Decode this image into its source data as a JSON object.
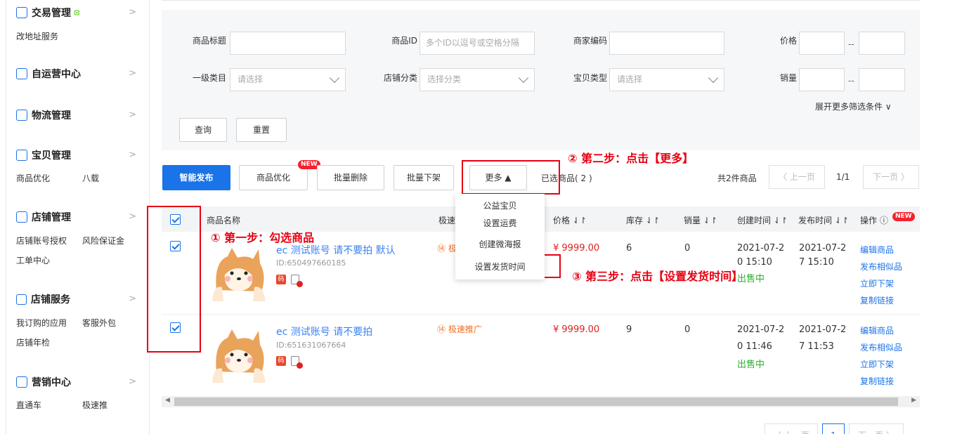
{
  "sidebar": {
    "sections": [
      {
        "title": "交易管理",
        "subs": [
          "改地址服务"
        ]
      },
      {
        "title": "自运营中心",
        "subs": []
      },
      {
        "title": "物流管理",
        "subs": []
      },
      {
        "title": "宝贝管理",
        "subs": [
          "商品优化",
          "八载"
        ]
      },
      {
        "title": "店铺管理",
        "subs": [
          "店铺账号授权",
          "风险保证金",
          "工单中心"
        ]
      },
      {
        "title": "店铺服务",
        "subs": [
          "我订购的应用",
          "客服外包",
          "店铺年检"
        ]
      },
      {
        "title": "营销中心",
        "subs": [
          "直通车",
          "极速推"
        ]
      }
    ],
    "chevron": ">"
  },
  "filter": {
    "labels": {
      "title": "商品标题",
      "id": "商品ID",
      "merchant_code": "商家编码",
      "price": "价格",
      "category": "一级类目",
      "shop_category": "店铺分类",
      "item_type": "宝贝类型",
      "sales": "销量"
    },
    "placeholders": {
      "id": "多个ID以逗号或空格分隔",
      "category": "请选择",
      "shop_category": "选择分类",
      "item_type": "请选择"
    },
    "range_sep": "--",
    "expand": "展开更多筛选条件 ∨",
    "query_btn": "查询",
    "reset_btn": "重置"
  },
  "toolbar": {
    "smart_publish": "智能发布",
    "optimize": "商品优化",
    "optimize_badge": "NEW",
    "batch_delete": "批量删除",
    "batch_offshelf": "批量下架",
    "more": "更多 ▲",
    "selected": "已选商品( 2 )",
    "total": "共2件商品",
    "prev": "〈 上一页",
    "page": "1/1",
    "next": "下一页 〉"
  },
  "more_menu": [
    "公益宝贝",
    "设置运费",
    "创建微海报",
    "设置发货时间"
  ],
  "table": {
    "headers": {
      "name": "商品名称",
      "promo": "极速",
      "price": "价格 ⇃↾",
      "stock": "库存 ⇃↾",
      "sales": "销量 ⇃↾",
      "created": "创建时间 ⇃↾",
      "published": "发布时间 ⇃↾",
      "ops": "操作 ⓘ",
      "ops_badge": "NEW"
    },
    "rows": [
      {
        "title": "ec 测试账号 请不要拍 默认",
        "id": "ID:650497660185",
        "promo": "⑭ 极",
        "price": "¥ 9999.00",
        "stock": "6",
        "sales": "0",
        "created_1": "2021-07-2",
        "created_2": "0 15:10",
        "published_1": "2021-07-2",
        "published_2": "7 15:10",
        "status": "出售中",
        "ops": [
          "编辑商品",
          "发布相似品",
          "立即下架",
          "复制链接"
        ],
        "tag": "码"
      },
      {
        "title": "ec 测试账号 请不要拍",
        "id": "ID:651631067664",
        "promo": "⑭ 极速推广",
        "price": "¥ 9999.00",
        "stock": "9",
        "sales": "0",
        "created_1": "2021-07-2",
        "created_2": "0 11:46",
        "published_1": "2021-07-2",
        "published_2": "7 11:53",
        "status": "出售中",
        "ops": [
          "编辑商品",
          "发布相似品",
          "立即下架",
          "复制链接"
        ],
        "tag": "码"
      }
    ]
  },
  "annotations": {
    "step1": "① 第一步：勾选商品",
    "step2": "② 第二步：点击【更多】",
    "step3": "③ 第三步：点击【设置发货时间】"
  },
  "bottom_pager": {
    "prev": "〈 上一页",
    "current": "1",
    "next": "下一页 〉"
  },
  "colors": {
    "primary": "#1a73e8",
    "annotation_red": "#e60012",
    "price_red": "#e02020",
    "status_green": "#2cae2c"
  }
}
